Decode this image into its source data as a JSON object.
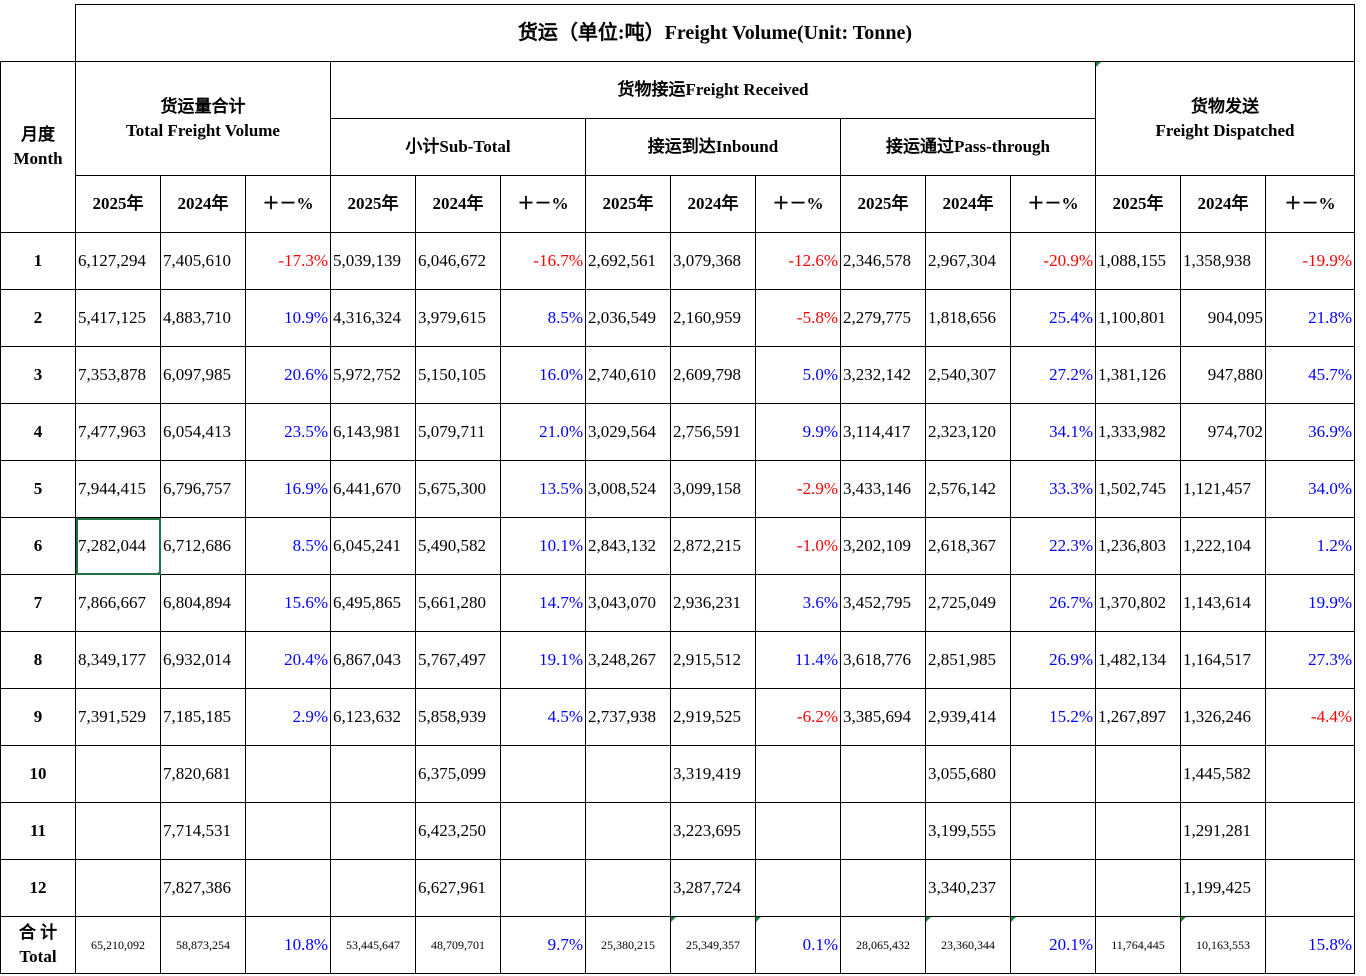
{
  "title": "货运（单位:吨）Freight Volume(Unit:   Tonne)",
  "headers": {
    "month_cn": "月度",
    "month_en": "Month",
    "total_cn": "货运量合计",
    "total_en": "Total Freight Volume",
    "received": "货物接运Freight Received",
    "subtotal": "小计Sub-Total",
    "inbound": "接运到达Inbound",
    "passthrough": "接运通过Pass-through",
    "dispatched_cn": "货物发送",
    "dispatched_en": "Freight Dispatched",
    "y2025": "2025年",
    "y2024": "2024年",
    "pct": "＋－%"
  },
  "rows": [
    {
      "month": "1",
      "c": [
        "6,127,294",
        "7,405,610",
        "-17.3%",
        "5,039,139",
        "6,046,672",
        "-16.7%",
        "2,692,561",
        "3,079,368",
        "-12.6%",
        "2,346,578",
        "2,967,304",
        "-20.9%",
        "1,088,155",
        "1,358,938",
        "-19.9%"
      ]
    },
    {
      "month": "2",
      "c": [
        "5,417,125",
        "4,883,710",
        "10.9%",
        "4,316,324",
        "3,979,615",
        "8.5%",
        "2,036,549",
        "2,160,959",
        "-5.8%",
        "2,279,775",
        "1,818,656",
        "25.4%",
        "1,100,801",
        "904,095",
        "21.8%"
      ]
    },
    {
      "month": "3",
      "c": [
        "7,353,878",
        "6,097,985",
        "20.6%",
        "5,972,752",
        "5,150,105",
        "16.0%",
        "2,740,610",
        "2,609,798",
        "5.0%",
        "3,232,142",
        "2,540,307",
        "27.2%",
        "1,381,126",
        "947,880",
        "45.7%"
      ]
    },
    {
      "month": "4",
      "c": [
        "7,477,963",
        "6,054,413",
        "23.5%",
        "6,143,981",
        "5,079,711",
        "21.0%",
        "3,029,564",
        "2,756,591",
        "9.9%",
        "3,114,417",
        "2,323,120",
        "34.1%",
        "1,333,982",
        "974,702",
        "36.9%"
      ]
    },
    {
      "month": "5",
      "c": [
        "7,944,415",
        "6,796,757",
        "16.9%",
        "6,441,670",
        "5,675,300",
        "13.5%",
        "3,008,524",
        "3,099,158",
        "-2.9%",
        "3,433,146",
        "2,576,142",
        "33.3%",
        "1,502,745",
        "1,121,457",
        "34.0%"
      ]
    },
    {
      "month": "6",
      "c": [
        "7,282,044",
        "6,712,686",
        "8.5%",
        "6,045,241",
        "5,490,582",
        "10.1%",
        "2,843,132",
        "2,872,215",
        "-1.0%",
        "3,202,109",
        "2,618,367",
        "22.3%",
        "1,236,803",
        "1,222,104",
        "1.2%"
      ]
    },
    {
      "month": "7",
      "c": [
        "7,866,667",
        "6,804,894",
        "15.6%",
        "6,495,865",
        "5,661,280",
        "14.7%",
        "3,043,070",
        "2,936,231",
        "3.6%",
        "3,452,795",
        "2,725,049",
        "26.7%",
        "1,370,802",
        "1,143,614",
        "19.9%"
      ]
    },
    {
      "month": "8",
      "c": [
        "8,349,177",
        "6,932,014",
        "20.4%",
        "6,867,043",
        "5,767,497",
        "19.1%",
        "3,248,267",
        "2,915,512",
        "11.4%",
        "3,618,776",
        "2,851,985",
        "26.9%",
        "1,482,134",
        "1,164,517",
        "27.3%"
      ]
    },
    {
      "month": "9",
      "c": [
        "7,391,529",
        "7,185,185",
        "2.9%",
        "6,123,632",
        "5,858,939",
        "4.5%",
        "2,737,938",
        "2,919,525",
        "-6.2%",
        "3,385,694",
        "2,939,414",
        "15.2%",
        "1,267,897",
        "1,326,246",
        "-4.4%"
      ]
    },
    {
      "month": "10",
      "c": [
        "",
        "7,820,681",
        "",
        "",
        "6,375,099",
        "",
        "",
        "3,319,419",
        "",
        "",
        "3,055,680",
        "",
        "",
        "1,445,582",
        ""
      ]
    },
    {
      "month": "11",
      "c": [
        "",
        "7,714,531",
        "",
        "",
        "6,423,250",
        "",
        "",
        "3,223,695",
        "",
        "",
        "3,199,555",
        "",
        "",
        "1,291,281",
        ""
      ]
    },
    {
      "month": "12",
      "c": [
        "",
        "7,827,386",
        "",
        "",
        "6,627,961",
        "",
        "",
        "3,287,724",
        "",
        "",
        "3,340,237",
        "",
        "",
        "1,199,425",
        ""
      ]
    }
  ],
  "total": {
    "label_cn": "合 计",
    "label_en": "Total",
    "c": [
      "65,210,092",
      "58,873,254",
      "10.8%",
      "53,445,647",
      "48,709,701",
      "9.7%",
      "25,380,215",
      "25,349,357",
      "0.1%",
      "28,065,432",
      "23,360,344",
      "20.1%",
      "11,764,445",
      "10,163,553",
      "15.8%"
    ]
  },
  "colors": {
    "negative": "#ff0000",
    "positive": "#0000ff",
    "selection": "#217346"
  }
}
